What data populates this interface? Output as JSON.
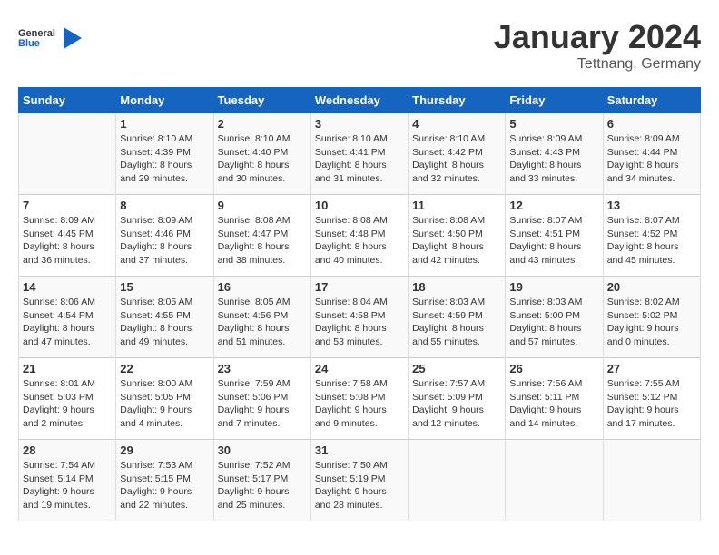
{
  "header": {
    "logo_general": "General",
    "logo_blue": "Blue",
    "month_title": "January 2024",
    "location": "Tettnang, Germany"
  },
  "days_of_week": [
    "Sunday",
    "Monday",
    "Tuesday",
    "Wednesday",
    "Thursday",
    "Friday",
    "Saturday"
  ],
  "weeks": [
    [
      {
        "day": "",
        "sunrise": "",
        "sunset": "",
        "daylight": ""
      },
      {
        "day": "1",
        "sunrise": "Sunrise: 8:10 AM",
        "sunset": "Sunset: 4:39 PM",
        "daylight": "Daylight: 8 hours and 29 minutes."
      },
      {
        "day": "2",
        "sunrise": "Sunrise: 8:10 AM",
        "sunset": "Sunset: 4:40 PM",
        "daylight": "Daylight: 8 hours and 30 minutes."
      },
      {
        "day": "3",
        "sunrise": "Sunrise: 8:10 AM",
        "sunset": "Sunset: 4:41 PM",
        "daylight": "Daylight: 8 hours and 31 minutes."
      },
      {
        "day": "4",
        "sunrise": "Sunrise: 8:10 AM",
        "sunset": "Sunset: 4:42 PM",
        "daylight": "Daylight: 8 hours and 32 minutes."
      },
      {
        "day": "5",
        "sunrise": "Sunrise: 8:09 AM",
        "sunset": "Sunset: 4:43 PM",
        "daylight": "Daylight: 8 hours and 33 minutes."
      },
      {
        "day": "6",
        "sunrise": "Sunrise: 8:09 AM",
        "sunset": "Sunset: 4:44 PM",
        "daylight": "Daylight: 8 hours and 34 minutes."
      }
    ],
    [
      {
        "day": "7",
        "sunrise": "Sunrise: 8:09 AM",
        "sunset": "Sunset: 4:45 PM",
        "daylight": "Daylight: 8 hours and 36 minutes."
      },
      {
        "day": "8",
        "sunrise": "Sunrise: 8:09 AM",
        "sunset": "Sunset: 4:46 PM",
        "daylight": "Daylight: 8 hours and 37 minutes."
      },
      {
        "day": "9",
        "sunrise": "Sunrise: 8:08 AM",
        "sunset": "Sunset: 4:47 PM",
        "daylight": "Daylight: 8 hours and 38 minutes."
      },
      {
        "day": "10",
        "sunrise": "Sunrise: 8:08 AM",
        "sunset": "Sunset: 4:48 PM",
        "daylight": "Daylight: 8 hours and 40 minutes."
      },
      {
        "day": "11",
        "sunrise": "Sunrise: 8:08 AM",
        "sunset": "Sunset: 4:50 PM",
        "daylight": "Daylight: 8 hours and 42 minutes."
      },
      {
        "day": "12",
        "sunrise": "Sunrise: 8:07 AM",
        "sunset": "Sunset: 4:51 PM",
        "daylight": "Daylight: 8 hours and 43 minutes."
      },
      {
        "day": "13",
        "sunrise": "Sunrise: 8:07 AM",
        "sunset": "Sunset: 4:52 PM",
        "daylight": "Daylight: 8 hours and 45 minutes."
      }
    ],
    [
      {
        "day": "14",
        "sunrise": "Sunrise: 8:06 AM",
        "sunset": "Sunset: 4:54 PM",
        "daylight": "Daylight: 8 hours and 47 minutes."
      },
      {
        "day": "15",
        "sunrise": "Sunrise: 8:05 AM",
        "sunset": "Sunset: 4:55 PM",
        "daylight": "Daylight: 8 hours and 49 minutes."
      },
      {
        "day": "16",
        "sunrise": "Sunrise: 8:05 AM",
        "sunset": "Sunset: 4:56 PM",
        "daylight": "Daylight: 8 hours and 51 minutes."
      },
      {
        "day": "17",
        "sunrise": "Sunrise: 8:04 AM",
        "sunset": "Sunset: 4:58 PM",
        "daylight": "Daylight: 8 hours and 53 minutes."
      },
      {
        "day": "18",
        "sunrise": "Sunrise: 8:03 AM",
        "sunset": "Sunset: 4:59 PM",
        "daylight": "Daylight: 8 hours and 55 minutes."
      },
      {
        "day": "19",
        "sunrise": "Sunrise: 8:03 AM",
        "sunset": "Sunset: 5:00 PM",
        "daylight": "Daylight: 8 hours and 57 minutes."
      },
      {
        "day": "20",
        "sunrise": "Sunrise: 8:02 AM",
        "sunset": "Sunset: 5:02 PM",
        "daylight": "Daylight: 9 hours and 0 minutes."
      }
    ],
    [
      {
        "day": "21",
        "sunrise": "Sunrise: 8:01 AM",
        "sunset": "Sunset: 5:03 PM",
        "daylight": "Daylight: 9 hours and 2 minutes."
      },
      {
        "day": "22",
        "sunrise": "Sunrise: 8:00 AM",
        "sunset": "Sunset: 5:05 PM",
        "daylight": "Daylight: 9 hours and 4 minutes."
      },
      {
        "day": "23",
        "sunrise": "Sunrise: 7:59 AM",
        "sunset": "Sunset: 5:06 PM",
        "daylight": "Daylight: 9 hours and 7 minutes."
      },
      {
        "day": "24",
        "sunrise": "Sunrise: 7:58 AM",
        "sunset": "Sunset: 5:08 PM",
        "daylight": "Daylight: 9 hours and 9 minutes."
      },
      {
        "day": "25",
        "sunrise": "Sunrise: 7:57 AM",
        "sunset": "Sunset: 5:09 PM",
        "daylight": "Daylight: 9 hours and 12 minutes."
      },
      {
        "day": "26",
        "sunrise": "Sunrise: 7:56 AM",
        "sunset": "Sunset: 5:11 PM",
        "daylight": "Daylight: 9 hours and 14 minutes."
      },
      {
        "day": "27",
        "sunrise": "Sunrise: 7:55 AM",
        "sunset": "Sunset: 5:12 PM",
        "daylight": "Daylight: 9 hours and 17 minutes."
      }
    ],
    [
      {
        "day": "28",
        "sunrise": "Sunrise: 7:54 AM",
        "sunset": "Sunset: 5:14 PM",
        "daylight": "Daylight: 9 hours and 19 minutes."
      },
      {
        "day": "29",
        "sunrise": "Sunrise: 7:53 AM",
        "sunset": "Sunset: 5:15 PM",
        "daylight": "Daylight: 9 hours and 22 minutes."
      },
      {
        "day": "30",
        "sunrise": "Sunrise: 7:52 AM",
        "sunset": "Sunset: 5:17 PM",
        "daylight": "Daylight: 9 hours and 25 minutes."
      },
      {
        "day": "31",
        "sunrise": "Sunrise: 7:50 AM",
        "sunset": "Sunset: 5:19 PM",
        "daylight": "Daylight: 9 hours and 28 minutes."
      },
      {
        "day": "",
        "sunrise": "",
        "sunset": "",
        "daylight": ""
      },
      {
        "day": "",
        "sunrise": "",
        "sunset": "",
        "daylight": ""
      },
      {
        "day": "",
        "sunrise": "",
        "sunset": "",
        "daylight": ""
      }
    ]
  ]
}
